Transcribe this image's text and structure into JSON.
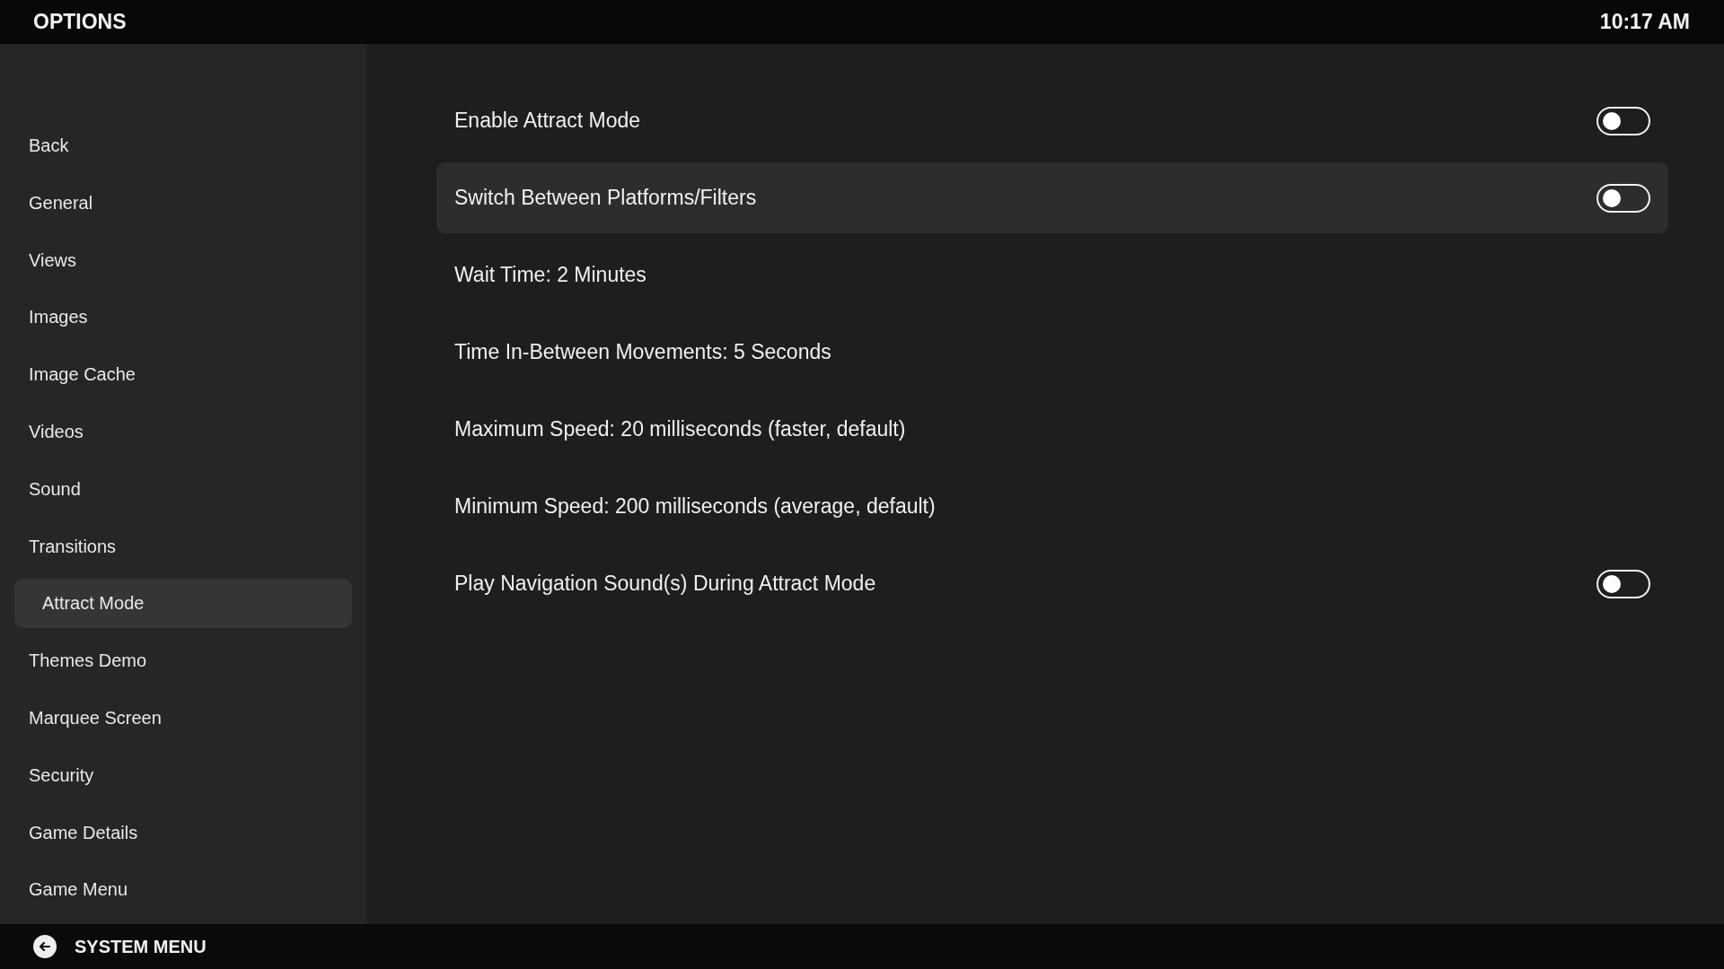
{
  "header": {
    "title": "OPTIONS",
    "time": "10:17 AM"
  },
  "sidebar": {
    "items": [
      {
        "label": "Back",
        "selected": false
      },
      {
        "label": "General",
        "selected": false
      },
      {
        "label": "Views",
        "selected": false
      },
      {
        "label": "Images",
        "selected": false
      },
      {
        "label": "Image Cache",
        "selected": false
      },
      {
        "label": "Videos",
        "selected": false
      },
      {
        "label": "Sound",
        "selected": false
      },
      {
        "label": "Transitions",
        "selected": false
      },
      {
        "label": "Attract Mode",
        "selected": true
      },
      {
        "label": "Themes Demo",
        "selected": false
      },
      {
        "label": "Marquee Screen",
        "selected": false
      },
      {
        "label": "Security",
        "selected": false
      },
      {
        "label": "Game Details",
        "selected": false
      },
      {
        "label": "Game Menu",
        "selected": false
      }
    ]
  },
  "settings": [
    {
      "kind": "toggle",
      "label": "Enable Attract Mode",
      "on": false,
      "selected": false
    },
    {
      "kind": "toggle",
      "label": "Switch Between Platforms/Filters",
      "on": false,
      "selected": true
    },
    {
      "kind": "value",
      "label": "Wait Time: 2 Minutes",
      "selected": false
    },
    {
      "kind": "value",
      "label": "Time In-Between Movements: 5 Seconds",
      "selected": false
    },
    {
      "kind": "value",
      "label": "Maximum Speed: 20 milliseconds (faster, default)",
      "selected": false
    },
    {
      "kind": "value",
      "label": "Minimum Speed: 200 milliseconds (average, default)",
      "selected": false
    },
    {
      "kind": "toggle",
      "label": "Play Navigation Sound(s) During Attract Mode",
      "on": false,
      "selected": false
    }
  ],
  "footer": {
    "label": "SYSTEM MENU"
  }
}
